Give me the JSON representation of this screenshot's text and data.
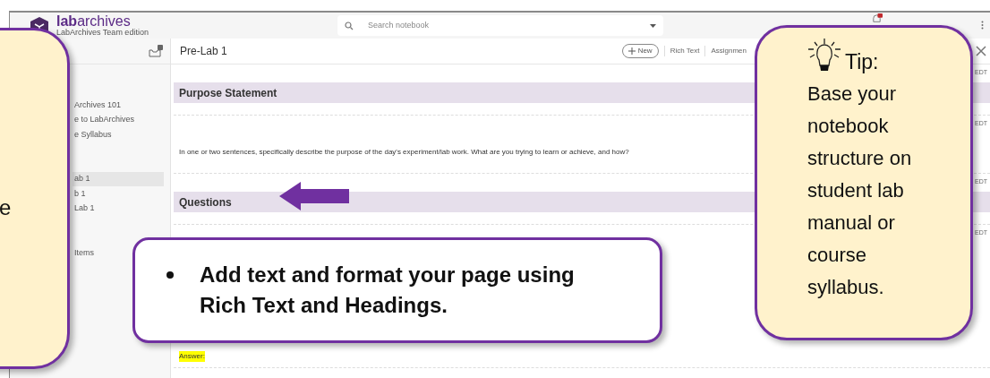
{
  "app": {
    "logo": {
      "name": "**lab**archives",
      "edition": "LabArchives Team edition"
    },
    "search": {
      "placeholder": "Search notebook"
    },
    "sidebar": {
      "groups": [
        [
          {
            "label": "Archives 101",
            "selected": false
          },
          {
            "label": "e to LabArchives",
            "selected": false
          },
          {
            "label": "e Syllabus",
            "selected": false
          }
        ],
        [
          {
            "label": "ab 1",
            "selected": true
          },
          {
            "label": "b 1",
            "selected": false
          },
          {
            "label": "Lab 1",
            "selected": false
          }
        ],
        [
          {
            "label": "Items",
            "selected": false
          }
        ]
      ]
    },
    "page": {
      "title": "Pre-Lab 1",
      "toolbar": [
        {
          "kind": "add",
          "label": "New"
        },
        {
          "kind": "plain",
          "label": "Rich Text"
        },
        {
          "kind": "plain",
          "label": "Assignmen"
        }
      ],
      "entries": [
        {
          "kind": "heading",
          "text": "Purpose Statement",
          "timestamp": "EDT"
        },
        {
          "kind": "text",
          "text": "In one or two sentences, specifically describe the purpose of the day's experiment/lab work. What are you trying to learn or achieve, and how?",
          "timestamp": "EDT",
          "highlighted": false
        },
        {
          "kind": "heading",
          "text": "Questions",
          "timestamp": "EDT"
        },
        {
          "kind": "text",
          "text": "Answer:",
          "timestamp": "EDT",
          "highlighted": true
        }
      ]
    }
  },
  "callouts": {
    "left": {
      "text": "e"
    },
    "bullet": {
      "items": [
        "Add text and format your page using Rich Text and Headings."
      ]
    },
    "tip": {
      "title": "Tip:",
      "text": "Base your notebook structure on student lab manual or course syllabus."
    }
  }
}
